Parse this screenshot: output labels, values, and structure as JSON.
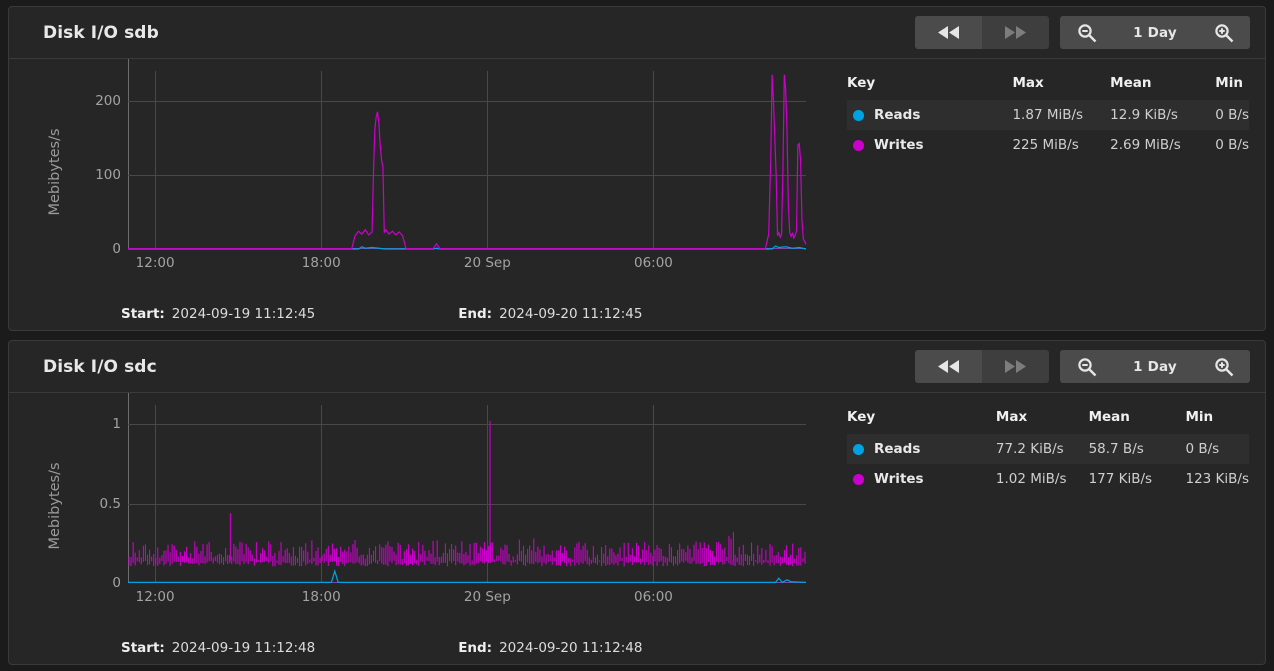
{
  "panels": [
    {
      "title": "Disk I/O sdb",
      "toolbar": {
        "rewind_icon": "rewind-icon",
        "forward_icon": "fast-forward-icon",
        "zoom_out_icon": "zoom-out-icon",
        "zoom_in_icon": "zoom-in-icon",
        "range_label": "1 Day"
      },
      "timerange": {
        "start_label": "Start:",
        "start_value": "2024-09-19 11:12:45",
        "end_label": "End:",
        "end_value": "2024-09-20 11:12:45"
      },
      "legend": {
        "headers": [
          "Key",
          "Max",
          "Mean",
          "Min"
        ],
        "rows": [
          {
            "name": "Reads",
            "color": "#00a2e2",
            "max": "1.87 MiB/s",
            "mean": "12.9 KiB/s",
            "min": "0 B/s"
          },
          {
            "name": "Writes",
            "color": "#cc00cc",
            "max": "225 MiB/s",
            "mean": "2.69 MiB/s",
            "min": "0 B/s"
          }
        ]
      },
      "chart_data": {
        "type": "line",
        "title": "Disk I/O sdb",
        "ylabel": "Mebibytes/s",
        "xlabel": "",
        "ylim": [
          0,
          240
        ],
        "yticks": [
          0,
          100,
          200
        ],
        "ytick_labels": [
          "0",
          "100",
          "200"
        ],
        "xticks": [
          "12:00",
          "18:00",
          "20 Sep",
          "06:00"
        ],
        "xtick_positions": [
          0.04,
          0.285,
          0.53,
          0.775
        ],
        "grid": true,
        "legend_position": "right",
        "series": [
          {
            "name": "Reads",
            "color": "#00a2e2",
            "points": [
              [
                0.0,
                0
              ],
              [
                0.34,
                0
              ],
              [
                0.345,
                3
              ],
              [
                0.35,
                1
              ],
              [
                0.36,
                2
              ],
              [
                0.37,
                1
              ],
              [
                0.38,
                0
              ],
              [
                0.45,
                0
              ],
              [
                0.455,
                1
              ],
              [
                0.46,
                0
              ],
              [
                0.95,
                0
              ],
              [
                0.955,
                4
              ],
              [
                0.96,
                2
              ],
              [
                0.97,
                3
              ],
              [
                0.98,
                1
              ],
              [
                0.99,
                2
              ],
              [
                1.0,
                0
              ]
            ]
          },
          {
            "name": "Writes",
            "color": "#cc00cc",
            "points": [
              [
                0.0,
                0.4
              ],
              [
                0.05,
                0.4
              ],
              [
                0.1,
                0.4
              ],
              [
                0.15,
                0.4
              ],
              [
                0.2,
                0.4
              ],
              [
                0.25,
                0.4
              ],
              [
                0.3,
                0.4
              ],
              [
                0.33,
                0.4
              ],
              [
                0.335,
                18
              ],
              [
                0.34,
                24
              ],
              [
                0.345,
                20
              ],
              [
                0.35,
                26
              ],
              [
                0.355,
                19
              ],
              [
                0.36,
                23
              ],
              [
                0.362,
                100
              ],
              [
                0.364,
                160
              ],
              [
                0.366,
                178
              ],
              [
                0.368,
                185
              ],
              [
                0.37,
                170
              ],
              [
                0.372,
                140
              ],
              [
                0.374,
                120
              ],
              [
                0.376,
                110
              ],
              [
                0.378,
                22
              ],
              [
                0.38,
                26
              ],
              [
                0.385,
                20
              ],
              [
                0.39,
                24
              ],
              [
                0.395,
                19
              ],
              [
                0.4,
                23
              ],
              [
                0.405,
                18
              ],
              [
                0.41,
                0.4
              ],
              [
                0.45,
                0.4
              ],
              [
                0.455,
                7
              ],
              [
                0.46,
                0.4
              ],
              [
                0.55,
                0.4
              ],
              [
                0.6,
                0.4
              ],
              [
                0.7,
                0.4
              ],
              [
                0.8,
                0.4
              ],
              [
                0.9,
                0.4
              ],
              [
                0.94,
                0.4
              ],
              [
                0.945,
                20
              ],
              [
                0.948,
                120
              ],
              [
                0.95,
                235
              ],
              [
                0.952,
                200
              ],
              [
                0.954,
                150
              ],
              [
                0.956,
                100
              ],
              [
                0.958,
                18
              ],
              [
                0.96,
                22
              ],
              [
                0.962,
                16
              ],
              [
                0.964,
                20
              ],
              [
                0.966,
                110
              ],
              [
                0.968,
                235
              ],
              [
                0.97,
                215
              ],
              [
                0.972,
                160
              ],
              [
                0.974,
                60
              ],
              [
                0.976,
                22
              ],
              [
                0.978,
                17
              ],
              [
                0.98,
                21
              ],
              [
                0.982,
                15
              ],
              [
                0.984,
                19
              ],
              [
                0.986,
                24
              ],
              [
                0.988,
                140
              ],
              [
                0.99,
                142
              ],
              [
                0.992,
                120
              ],
              [
                0.994,
                40
              ],
              [
                0.996,
                14
              ],
              [
                0.998,
                10
              ],
              [
                1.0,
                6
              ]
            ]
          }
        ]
      }
    },
    {
      "title": "Disk I/O sdc",
      "toolbar": {
        "rewind_icon": "rewind-icon",
        "forward_icon": "fast-forward-icon",
        "zoom_out_icon": "zoom-out-icon",
        "zoom_in_icon": "zoom-in-icon",
        "range_label": "1 Day"
      },
      "timerange": {
        "start_label": "Start:",
        "start_value": "2024-09-19 11:12:48",
        "end_label": "End:",
        "end_value": "2024-09-20 11:12:48"
      },
      "legend": {
        "headers": [
          "Key",
          "Max",
          "Mean",
          "Min"
        ],
        "rows": [
          {
            "name": "Reads",
            "color": "#00a2e2",
            "max": "77.2 KiB/s",
            "mean": "58.7 B/s",
            "min": "0 B/s"
          },
          {
            "name": "Writes",
            "color": "#cc00cc",
            "max": "1.02 MiB/s",
            "mean": "177 KiB/s",
            "min": "123 KiB/s"
          }
        ]
      },
      "chart_data": {
        "type": "line",
        "title": "Disk I/O sdc",
        "ylabel": "Mebibytes/s",
        "xlabel": "",
        "ylim": [
          0,
          1.12
        ],
        "yticks": [
          0,
          0.5,
          1
        ],
        "ytick_labels": [
          "0",
          "0.5",
          "1"
        ],
        "xticks": [
          "12:00",
          "18:00",
          "20 Sep",
          "06:00"
        ],
        "xtick_positions": [
          0.04,
          0.285,
          0.53,
          0.775
        ],
        "grid": true,
        "legend_position": "right",
        "series": [
          {
            "name": "Reads",
            "color": "#00a2e2",
            "points": [
              [
                0.0,
                0.004
              ],
              [
                0.1,
                0.004
              ],
              [
                0.3,
                0.004
              ],
              [
                0.305,
                0.075
              ],
              [
                0.31,
                0.004
              ],
              [
                0.5,
                0.004
              ],
              [
                0.7,
                0.004
              ],
              [
                0.9,
                0.004
              ],
              [
                0.955,
                0.004
              ],
              [
                0.96,
                0.03
              ],
              [
                0.965,
                0.004
              ],
              [
                0.972,
                0.02
              ],
              [
                0.978,
                0.008
              ],
              [
                1.0,
                0.004
              ]
            ]
          },
          {
            "name": "Writes",
            "color": "#cc00cc",
            "noise_band": [
              0.14,
              0.26
            ],
            "baseline": 0.177,
            "spikes": [
              [
                0.151,
                0.44
              ],
              [
                0.534,
                1.02
              ],
              [
                0.893,
                0.32
              ]
            ],
            "description": "dense high-frequency noise band oscillating roughly between 0.13 and 0.27 MiB/s across the full day"
          }
        ]
      }
    }
  ]
}
